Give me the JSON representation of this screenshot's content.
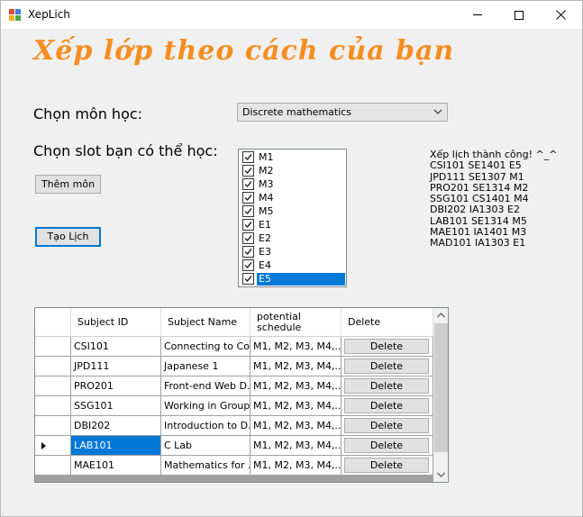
{
  "window": {
    "title": "XepLich"
  },
  "heading": "Xếp lớp theo cách của bạn",
  "subject_label": "Chọn môn học:",
  "subject_combo": {
    "selected": "Discrete mathematics"
  },
  "slot_label": "Chọn slot bạn có thể học:",
  "add_button": "Thêm môn",
  "create_button": "Tạo Lịch",
  "slots": [
    {
      "label": "M1",
      "checked": true
    },
    {
      "label": "M2",
      "checked": true
    },
    {
      "label": "M3",
      "checked": true
    },
    {
      "label": "M4",
      "checked": true
    },
    {
      "label": "M5",
      "checked": true
    },
    {
      "label": "E1",
      "checked": true
    },
    {
      "label": "E2",
      "checked": true
    },
    {
      "label": "E3",
      "checked": true
    },
    {
      "label": "E4",
      "checked": true
    },
    {
      "label": "E5",
      "checked": true,
      "selected": true
    }
  ],
  "result_lines": [
    "Xếp lịch thành công! ^_^",
    "CSI101 SE1401 E5",
    "JPD111 SE1307 M1",
    "PRO201 SE1314 M2",
    "SSG101 CS1401 M4",
    "DBI202 IA1303 E2",
    "LAB101 SE1314 M5",
    "MAE101 IA1401 M3",
    "MAD101 IA1303 E1"
  ],
  "grid": {
    "headers": {
      "subject_id": "Subject ID",
      "subject_name": "Subject Name",
      "potential_schedule": "potential schedule",
      "delete": "Delete"
    },
    "rows": [
      {
        "id": "CSI101",
        "name": "Connecting to Co...",
        "schedule": "M1, M2, M3, M4,...",
        "delete": "Delete"
      },
      {
        "id": "JPD111",
        "name": "Japanese 1",
        "schedule": "M1, M2, M3, M4,...",
        "delete": "Delete"
      },
      {
        "id": "PRO201",
        "name": "Front-end Web D...",
        "schedule": "M1, M2, M3, M4,...",
        "delete": "Delete"
      },
      {
        "id": "SSG101",
        "name": "Working in Group...",
        "schedule": "M1, M2, M3, M4,...",
        "delete": "Delete"
      },
      {
        "id": "DBI202",
        "name": "Introduction to D...",
        "schedule": "M1, M2, M3, M4,...",
        "delete": "Delete"
      },
      {
        "id": "LAB101",
        "name": "C Lab",
        "schedule": "M1, M2, M3, M4,...",
        "delete": "Delete",
        "current": true
      },
      {
        "id": "MAE101",
        "name": "Mathematics for ...",
        "schedule": "M1, M2, M3, M4,...",
        "delete": "Delete"
      }
    ]
  },
  "colors": {
    "heading": "#f58d1f",
    "selection": "#0078d7"
  }
}
